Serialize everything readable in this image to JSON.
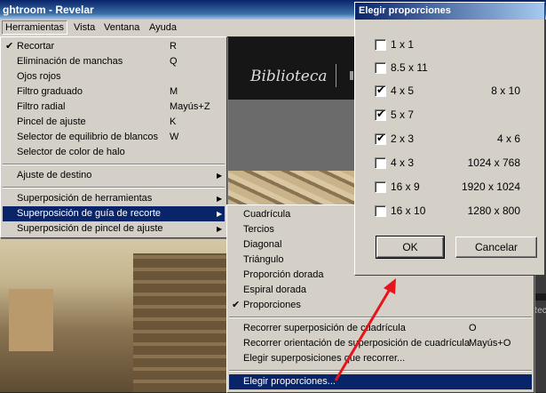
{
  "window": {
    "title": "ghtroom - Revelar"
  },
  "menubar": {
    "items": [
      "Herramientas",
      "Vista",
      "Ventana",
      "Ayuda"
    ]
  },
  "background": {
    "module_label": "Biblioteca",
    "right_panel_label": "Rec"
  },
  "tools_menu": {
    "items": [
      {
        "label": "Recortar",
        "shortcut": "R",
        "checked": true
      },
      {
        "label": "Eliminación de manchas",
        "shortcut": "Q"
      },
      {
        "label": "Ojos rojos",
        "shortcut": ""
      },
      {
        "label": "Filtro graduado",
        "shortcut": "M"
      },
      {
        "label": "Filtro radial",
        "shortcut": "Mayús+Z"
      },
      {
        "label": "Pincel de ajuste",
        "shortcut": "K"
      },
      {
        "label": "Selector de equilibrio de blancos",
        "shortcut": "W"
      },
      {
        "label": "Selector de color de halo",
        "shortcut": ""
      }
    ],
    "target": {
      "label": "Ajuste de destino"
    },
    "overlays": [
      {
        "label": "Superposición de herramientas"
      },
      {
        "label": "Superposición de guía de recorte",
        "highlighted": true
      },
      {
        "label": "Superposición de pincel de ajuste"
      }
    ]
  },
  "crop_overlay_menu": {
    "items": [
      {
        "label": "Cuadrícula"
      },
      {
        "label": "Tercios"
      },
      {
        "label": "Diagonal"
      },
      {
        "label": "Triángulo"
      },
      {
        "label": "Proporción dorada"
      },
      {
        "label": "Espiral dorada"
      },
      {
        "label": "Proporciones",
        "checked": true
      }
    ],
    "actions": [
      {
        "label": "Recorrer superposición de cuadrícula",
        "shortcut": "O"
      },
      {
        "label": "Recorrer orientación de superposición de cuadrícula",
        "shortcut": "Mayús+O"
      },
      {
        "label": "Elegir superposiciones que recorrer...",
        "shortcut": ""
      }
    ],
    "last": {
      "label": "Elegir proporciones...",
      "highlighted": true
    }
  },
  "dialog": {
    "title": "Elegir proporciones",
    "ratios": [
      {
        "ratio": "1 x 1",
        "resolution": "",
        "checked": false
      },
      {
        "ratio": "8.5 x 11",
        "resolution": "",
        "checked": false
      },
      {
        "ratio": "4 x 5",
        "resolution": "8 x 10",
        "checked": true
      },
      {
        "ratio": "5 x 7",
        "resolution": "",
        "checked": true
      },
      {
        "ratio": "2 x 3",
        "resolution": "4 x 6",
        "checked": true
      },
      {
        "ratio": "4 x 3",
        "resolution": "1024 x 768",
        "checked": false
      },
      {
        "ratio": "16 x 9",
        "resolution": "1920 x 1024",
        "checked": false
      },
      {
        "ratio": "16 x 10",
        "resolution": "1280 x 800",
        "checked": false
      }
    ],
    "ok_label": "OK",
    "cancel_label": "Cancelar"
  },
  "colors": {
    "highlight": "#0a246a",
    "menu_bg": "#d4d0c8",
    "arrow": "#e8141c"
  }
}
